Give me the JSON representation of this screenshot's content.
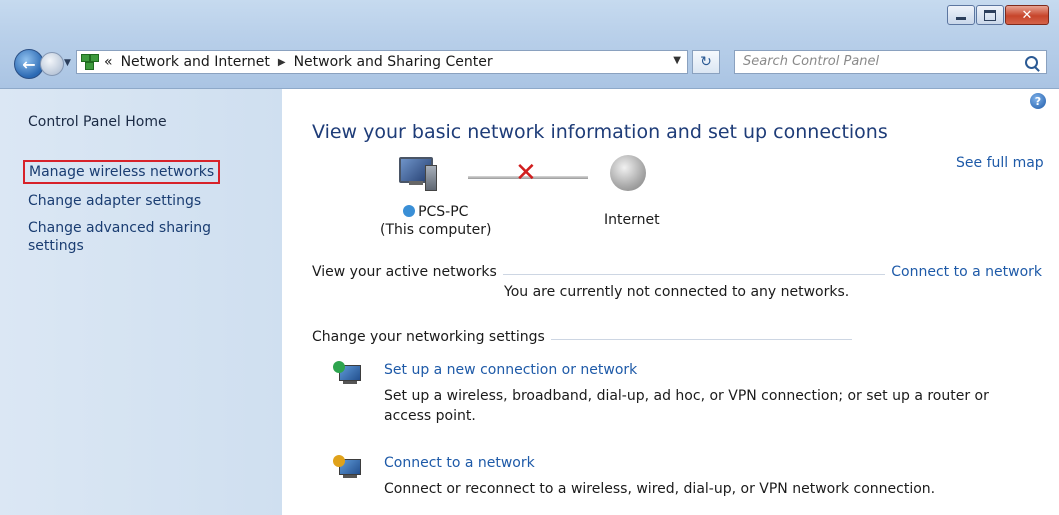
{
  "window": {
    "min_icon": "minimize-icon",
    "max_icon": "maximize-icon",
    "close_icon": "close-icon",
    "close_glyph": "✕"
  },
  "nav": {
    "back_glyph": "←",
    "crumb_sep": "«",
    "breadcrumbs": [
      "Network and Internet",
      "Network and Sharing Center"
    ],
    "refresh_glyph": "↻",
    "search_placeholder": "Search Control Panel"
  },
  "sidebar": {
    "home": "Control Panel Home",
    "items": [
      "Manage wireless networks",
      "Change adapter settings",
      "Change advanced sharing settings"
    ],
    "highlight_color": "#d7222a"
  },
  "main": {
    "help_glyph": "?",
    "title": "View your basic network information and set up connections",
    "see_full_map": "See full map",
    "computer_name": "PCS-PC",
    "computer_sub": "(This computer)",
    "internet_label": "Internet",
    "disconnect_glyph": "✕",
    "active_networks_label": "View your active networks",
    "connect_link": "Connect to a network",
    "not_connected": "You are currently not connected to any networks.",
    "change_settings_label": "Change your networking settings",
    "tasks": [
      {
        "title": "Set up a new connection or network",
        "desc": "Set up a wireless, broadband, dial-up, ad hoc, or VPN connection; or set up a router or access point."
      },
      {
        "title": "Connect to a network",
        "desc": "Connect or reconnect to a wireless, wired, dial-up, or VPN network connection."
      }
    ],
    "link_color": "#1e5aa8"
  }
}
